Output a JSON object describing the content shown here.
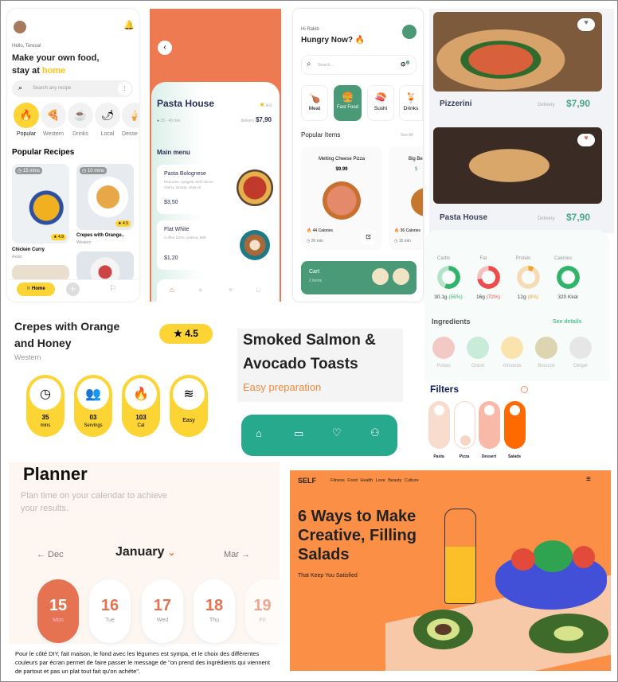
{
  "app1": {
    "greeting": "Hello, Teresa!",
    "headline1": "Make your own food,",
    "headline2": "stay at ",
    "headline_accent": "home",
    "search_placeholder": "Search any recipe",
    "categories": [
      {
        "label": "Popular",
        "icon": "fire-icon"
      },
      {
        "label": "Western",
        "icon": "pizza-icon"
      },
      {
        "label": "Drinks",
        "icon": "cup-icon"
      },
      {
        "label": "Local",
        "icon": "chili-icon"
      },
      {
        "label": "Desse",
        "icon": "ice-cream-icon"
      }
    ],
    "section": "Popular Recipes",
    "recipes": [
      {
        "name": "Chicken Curry",
        "cuisine": "Asian",
        "rating": "4.8",
        "time": "15 mins"
      },
      {
        "name": "Crepes with Orange..",
        "cuisine": "Western",
        "rating": "4.5",
        "time": "10 mins"
      }
    ],
    "nav": {
      "home": "Home"
    },
    "accent": "#fcd535"
  },
  "app2": {
    "title": "Pasta House",
    "rating": "4.6",
    "time": "25 - 40 min",
    "delivery_label": "delivery",
    "delivery_price": "$7,90",
    "section": "Main menu",
    "items": [
      {
        "name": "Pasta Bolognese",
        "desc1": "Red wine, spagetti, beef mince,",
        "desc2": "cherry, tomato, olive oil",
        "price": "$3,50"
      },
      {
        "name": "Flat White",
        "desc1": "Coffee 100% Arabica, Milk",
        "desc2": "",
        "price": "$1,20"
      }
    ],
    "accent": "#ee7a52"
  },
  "app3": {
    "greeting": "Hi Rakib",
    "headline": "Hungry Now? 🔥",
    "search_placeholder": "Search...",
    "filter_badge": "2",
    "categories": [
      {
        "label": "Meat",
        "emoji": "🍗"
      },
      {
        "label": "Fast Food",
        "emoji": "🍔"
      },
      {
        "label": "Sushi",
        "emoji": "🍣"
      },
      {
        "label": "Drinks",
        "emoji": "🍹"
      }
    ],
    "section": "Popular Items",
    "see_all": "See All",
    "items": [
      {
        "name": "Melting Cheese Pizza",
        "price": "$9.99",
        "calories": "44 Calories",
        "time": "20 min"
      },
      {
        "name": "Big Be",
        "price": "$",
        "calories": "36 Calories",
        "time": "15 min"
      }
    ],
    "cart": {
      "label": "Cart",
      "count": "2 items"
    },
    "accent": "#4a9a78"
  },
  "app4": {
    "restaurants": [
      {
        "name": "Pizzerini",
        "delivery": "Delivery",
        "price": "$7,90"
      },
      {
        "name": "Pasta House",
        "delivery": "Delivery",
        "price": "$7,90"
      }
    ]
  },
  "nutrition": {
    "items": [
      {
        "label": "Carbs",
        "value": "30.1g",
        "pct": "(56%)",
        "fraction": 0.56,
        "color": "#2fb46a"
      },
      {
        "label": "Fat",
        "value": "16g",
        "pct": "(72%)",
        "fraction": 0.72,
        "color": "#ee4c4c"
      },
      {
        "label": "Protein",
        "value": "12g",
        "pct": "(8%)",
        "fraction": 0.08,
        "color": "#f5a02a"
      },
      {
        "label": "Calories",
        "value": "320 Kkal",
        "pct": "",
        "fraction": 1,
        "color": "#2fb46a"
      }
    ],
    "ingredients_title": "Ingredients",
    "see_details": "See details",
    "ingredients": [
      {
        "name": "Potato",
        "bg": "#f3c9c6"
      },
      {
        "name": "Onion",
        "bg": "#c8ecd8"
      },
      {
        "name": "Almonds",
        "bg": "#fbe3ae"
      },
      {
        "name": "Broccoli",
        "bg": "#ddd5b0"
      },
      {
        "name": "Ginger",
        "bg": "#e6e6e6"
      }
    ]
  },
  "filters": {
    "title": "Filters",
    "items": [
      "Pasta",
      "Pizza",
      "Dessert",
      "Salads"
    ]
  },
  "recipe_detail": {
    "title1": "Crepes with Orange",
    "title2": "and Honey",
    "cuisine": "Western",
    "rating": "4.5",
    "stats": [
      {
        "value": "35",
        "unit": "mins",
        "icon": "clock-icon"
      },
      {
        "value": "03",
        "unit": "Servings",
        "icon": "people-icon"
      },
      {
        "value": "103",
        "unit": "Cal",
        "icon": "fire-icon"
      },
      {
        "value": "",
        "unit": "Easy",
        "icon": "layers-icon"
      }
    ]
  },
  "salmon": {
    "title1": "Smoked Salmon &",
    "title2": "Avocado Toasts",
    "subtitle": "Easy preparation",
    "nav_color": "#26a98c"
  },
  "planner": {
    "title": "Planner",
    "subtitle1": "Plan time on your calendar to achieve",
    "subtitle2": "your results.",
    "prev": "← Dec",
    "month": "January",
    "next": "Mar →",
    "days": [
      {
        "n": "15",
        "w": "Mon"
      },
      {
        "n": "16",
        "w": "Tue"
      },
      {
        "n": "17",
        "w": "Wed"
      },
      {
        "n": "18",
        "w": "Thu"
      },
      {
        "n": "19",
        "w": "Fri"
      }
    ]
  },
  "self": {
    "logo": "SELF",
    "nav": [
      "Fitness",
      "Food",
      "Health",
      "Love",
      "Beauty",
      "Culture"
    ],
    "title1": "6 Ways to Make",
    "title2": "Creative, Filling",
    "title3": "Salads",
    "subtitle": "That Keep You Satisfied",
    "bg": "#fb8f45"
  },
  "caption": "Pour le côté DIY, fait maison, le fond avec les légumes est sympa, et le choix des différentes couleurs par écran permet de faire passer le message de \"on prend des ingrédients qui viennent de partout et pas un plat tout fait qu'on achète\"."
}
